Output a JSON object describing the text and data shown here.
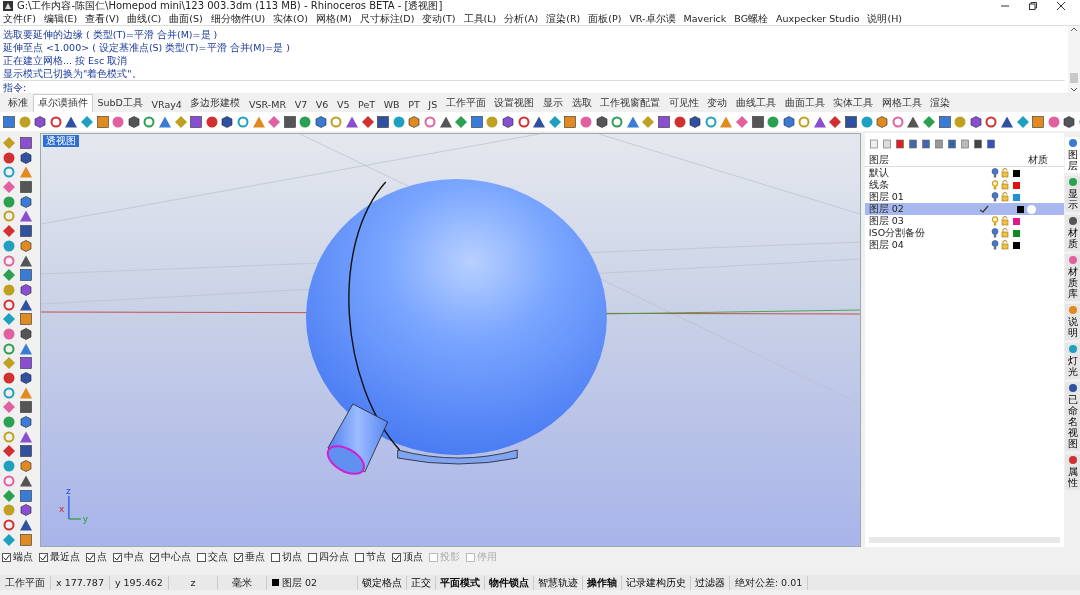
{
  "window": {
    "title": "G:\\工作内容-陈国仁\\Homepod mini\\123 003.3dm (113 MB) - Rhinoceros BETA - [透视图]"
  },
  "menu": [
    "文件(F)",
    "编辑(E)",
    "查看(V)",
    "曲线(C)",
    "曲面(S)",
    "细分物件(U)",
    "实体(O)",
    "网格(M)",
    "尺寸标注(D)",
    "变动(T)",
    "工具(L)",
    "分析(A)",
    "渲染(R)",
    "面板(P)",
    "VR-卓尔谟",
    "Maverick",
    "BG螺栓",
    "Auxpecker Studio",
    "说明(H)"
  ],
  "command_history": [
    "选取要延伸的边缘 ( 类型(T)=平滑  合并(M)=是 )",
    "延伸至点 <1.000> ( 设定基准点(S)  类型(T)=平滑  合并(M)=是 )",
    "正在建立网格... 按 Esc 取消",
    "显示模式已切换为\"着色模式\"。"
  ],
  "command_prompt": "指令:",
  "toolbar_tabs": [
    {
      "label": "标准",
      "selected": false
    },
    {
      "label": "卓尔谟插件",
      "selected": true
    },
    {
      "label": "SubD工具",
      "selected": false
    },
    {
      "label": "VRay4",
      "selected": false
    },
    {
      "label": "多边形建模",
      "selected": false
    },
    {
      "label": "VSR-MR",
      "selected": false
    },
    {
      "label": "V7",
      "selected": false
    },
    {
      "label": "V6",
      "selected": false
    },
    {
      "label": "V5",
      "selected": false
    },
    {
      "label": "PeT",
      "selected": false
    },
    {
      "label": "WB",
      "selected": false
    },
    {
      "label": "PT",
      "selected": false
    },
    {
      "label": "JS",
      "selected": false
    },
    {
      "label": "工作平面",
      "selected": false
    },
    {
      "label": "设置视图",
      "selected": false
    },
    {
      "label": "显示",
      "selected": false
    },
    {
      "label": "选取",
      "selected": false
    },
    {
      "label": "工作视窗配置",
      "selected": false
    },
    {
      "label": "可见性",
      "selected": false
    },
    {
      "label": "变动",
      "selected": false
    },
    {
      "label": "曲线工具",
      "selected": false
    },
    {
      "label": "曲面工具",
      "selected": false
    },
    {
      "label": "实体工具",
      "selected": false
    },
    {
      "label": "网格工具",
      "selected": false
    },
    {
      "label": "渲染",
      "selected": false
    }
  ],
  "viewport": {
    "label": "透视图",
    "axes": [
      "x",
      "y",
      "z"
    ]
  },
  "layers_panel": {
    "columns": [
      "图层",
      "材质"
    ],
    "layers": [
      {
        "name": "默认",
        "selected": false,
        "current": false,
        "bulb_highlight": false,
        "color": "#000000"
      },
      {
        "name": "线条",
        "selected": false,
        "current": false,
        "bulb_highlight": true,
        "color": "#e01010"
      },
      {
        "name": "图层 01",
        "selected": false,
        "current": false,
        "bulb_highlight": false,
        "color": "#1e90e0"
      },
      {
        "name": "图层 02",
        "selected": true,
        "current": true,
        "color": "#000000"
      },
      {
        "name": "图层 03",
        "selected": false,
        "current": false,
        "bulb_highlight": true,
        "color": "#e0188c"
      },
      {
        "name": "ISO分割备份",
        "selected": false,
        "current": false,
        "bulb_highlight": false,
        "color": "#108a20"
      },
      {
        "name": "图层 04",
        "selected": false,
        "current": false,
        "bulb_highlight": false,
        "color": "#000000"
      }
    ]
  },
  "side_tabs": [
    {
      "label": "图层",
      "selected": true
    },
    {
      "label": "显示",
      "selected": false
    },
    {
      "label": "材质",
      "selected": false
    },
    {
      "label": "材质库",
      "selected": false
    },
    {
      "label": "说明",
      "selected": false
    },
    {
      "label": "灯光",
      "selected": false
    },
    {
      "label": "已命名视图",
      "selected": false
    },
    {
      "label": "属性",
      "selected": false
    }
  ],
  "osnaps": [
    {
      "label": "端点",
      "checked": true,
      "disabled": false
    },
    {
      "label": "最近点",
      "checked": true,
      "disabled": false
    },
    {
      "label": "点",
      "checked": true,
      "disabled": false
    },
    {
      "label": "中点",
      "checked": true,
      "disabled": false
    },
    {
      "label": "中心点",
      "checked": true,
      "disabled": false
    },
    {
      "label": "交点",
      "checked": false,
      "disabled": false
    },
    {
      "label": "垂点",
      "checked": true,
      "disabled": false
    },
    {
      "label": "切点",
      "checked": false,
      "disabled": false
    },
    {
      "label": "四分点",
      "checked": false,
      "disabled": false
    },
    {
      "label": "节点",
      "checked": false,
      "disabled": false
    },
    {
      "label": "顶点",
      "checked": true,
      "disabled": false
    },
    {
      "label": "投影",
      "checked": false,
      "disabled": true
    },
    {
      "label": "停用",
      "checked": false,
      "disabled": true
    }
  ],
  "status_bar": [
    {
      "kind": "field",
      "text": "工作平面"
    },
    {
      "kind": "field",
      "text": "x 177.787"
    },
    {
      "kind": "field",
      "text": "y 195.462"
    },
    {
      "kind": "field",
      "text": "z"
    },
    {
      "kind": "field",
      "text": "毫米"
    },
    {
      "kind": "layer",
      "text": "图层 02",
      "color": "#000000"
    },
    {
      "kind": "toggle",
      "text": "锁定格点",
      "on": false
    },
    {
      "kind": "toggle",
      "text": "正交",
      "on": false
    },
    {
      "kind": "toggle",
      "text": "平面模式",
      "on": true
    },
    {
      "kind": "toggle",
      "text": "物件锁点",
      "on": true
    },
    {
      "kind": "toggle",
      "text": "智慧轨迹",
      "on": false
    },
    {
      "kind": "toggle",
      "text": "操作轴",
      "on": true
    },
    {
      "kind": "toggle",
      "text": "记录建构历史",
      "on": false
    },
    {
      "kind": "toggle",
      "text": "过滤器",
      "on": false
    },
    {
      "kind": "field",
      "text": "绝对公差: 0.01"
    }
  ]
}
